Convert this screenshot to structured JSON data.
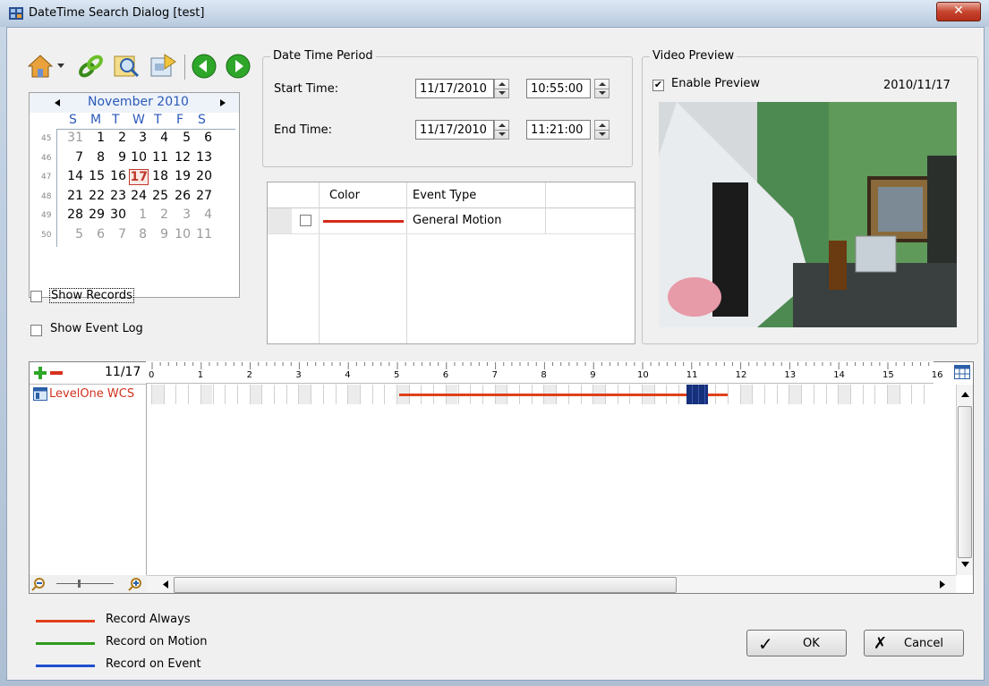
{
  "window": {
    "title": "DateTime Search Dialog  [test]"
  },
  "calendar": {
    "month_label": "November 2010",
    "day_headers": [
      "S",
      "M",
      "T",
      "W",
      "T",
      "F",
      "S"
    ],
    "week_numbers": [
      "45",
      "46",
      "47",
      "48",
      "49",
      "50"
    ],
    "weeks": [
      [
        "31",
        "1",
        "2",
        "3",
        "4",
        "5",
        "6"
      ],
      [
        "7",
        "8",
        "9",
        "10",
        "11",
        "12",
        "13"
      ],
      [
        "14",
        "15",
        "16",
        "17",
        "18",
        "19",
        "20"
      ],
      [
        "21",
        "22",
        "23",
        "24",
        "25",
        "26",
        "27"
      ],
      [
        "28",
        "29",
        "30",
        "1",
        "2",
        "3",
        "4"
      ],
      [
        "5",
        "6",
        "7",
        "8",
        "9",
        "10",
        "11"
      ]
    ],
    "selected_day": "17"
  },
  "options": {
    "show_records": "Show Records",
    "show_event_log": "Show Event Log"
  },
  "period": {
    "title": "Date Time Period",
    "start_label": "Start Time:",
    "start_date": "11/17/2010",
    "start_time": "10:55:00",
    "end_label": "End Time:",
    "end_date": "11/17/2010",
    "end_time": "11:21:00"
  },
  "event_table": {
    "headers": [
      "Color",
      "Event Type"
    ],
    "rows": [
      {
        "event_type": "General Motion",
        "color": "#d42a1a"
      }
    ]
  },
  "preview": {
    "title": "Video Preview",
    "enable_label": "Enable Preview",
    "date": "2010/11/17"
  },
  "timeline": {
    "date_label": "11/17",
    "hours": [
      "0",
      "1",
      "2",
      "3",
      "4",
      "5",
      "6",
      "7",
      "8",
      "9",
      "10",
      "11",
      "12",
      "13",
      "14",
      "15",
      "16"
    ],
    "camera": "LevelOne WCS",
    "record_color": "#e0401a",
    "selection_color": "#17307a"
  },
  "legend": [
    {
      "label": "Record Always",
      "color": "#e0401a"
    },
    {
      "label": "Record on Motion",
      "color": "#2f9a1c"
    },
    {
      "label": "Record on Event",
      "color": "#1f4fd0"
    }
  ],
  "buttons": {
    "ok": "OK",
    "cancel": "Cancel"
  },
  "icons": [
    "home-icon",
    "dropdown-arrow-icon",
    "link-icon",
    "search-icon",
    "export-icon",
    "previous-icon",
    "next-icon",
    "zoom-in-icon",
    "zoom-out-icon",
    "add-icon",
    "remove-icon",
    "calendar-grid-icon"
  ]
}
